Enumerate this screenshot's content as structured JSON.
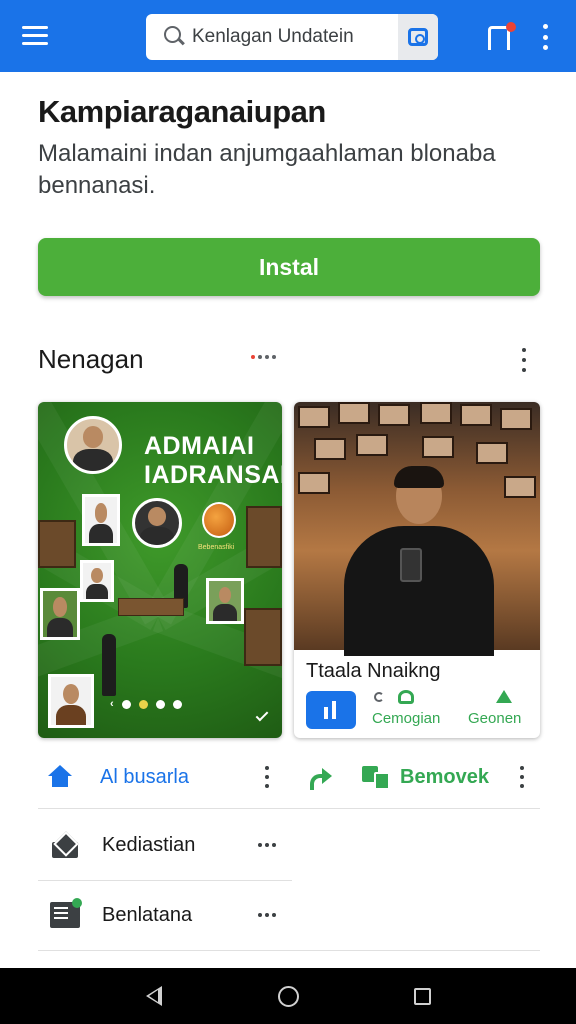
{
  "topbar": {
    "search_value": "Kenlagan Undatein",
    "background_color": "#1a73e8",
    "icons": [
      "menu-icon",
      "search-icon",
      "camera-icon",
      "notification-icon",
      "more-vertical-icon"
    ]
  },
  "app": {
    "title": "Kampiaraganaiupan",
    "description": "Malamaini indan anjumgaahlaman blonaba bennanasi.",
    "install_label": "Instal",
    "install_color": "#4caf3a"
  },
  "section": {
    "title": "Nenagan"
  },
  "cards": {
    "left": {
      "headline_line1": "ADMAIAI",
      "headline_line2": "IADRANSAI",
      "orange_caption": "Bebenasfiki",
      "background_color": "#2a7a1d"
    },
    "right": {
      "caption": "Ttaala Nnaikng",
      "action_b_label": "Cemogian",
      "action_c_label": "Geonen"
    }
  },
  "actions_row": {
    "left_label": "Al busarla",
    "right_label": "Bemovek",
    "left_color": "#1a73e8",
    "right_color": "#34a853"
  },
  "list": [
    {
      "label": "Kediastian",
      "icon": "mail-icon"
    },
    {
      "label": "Benlatana",
      "icon": "document-icon"
    }
  ],
  "navbar": {
    "buttons": [
      "back-icon",
      "home-icon",
      "recent-apps-icon"
    ]
  }
}
